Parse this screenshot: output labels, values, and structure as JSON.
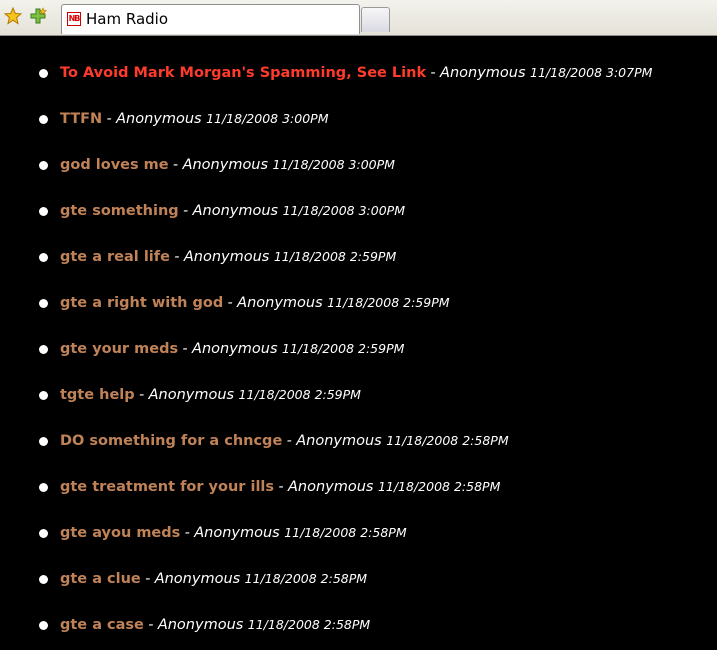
{
  "browser": {
    "tab_title": "Ham Radio",
    "tab_favicon_text": "NB",
    "icons": [
      "star-icon",
      "add-bookmark-icon",
      "favicon-icon"
    ]
  },
  "colors": {
    "background": "#000000",
    "link": "#c08257",
    "link_highlight": "#ff3b2b",
    "text": "#ffffff"
  },
  "posts": [
    {
      "title": "To Avoid Mark Morgan's Spamming, See Link",
      "author": "Anonymous",
      "date": "11/18/2008 3:07PM",
      "highlight": true
    },
    {
      "title": "TTFN",
      "author": "Anonymous",
      "date": "11/18/2008 3:00PM"
    },
    {
      "title": "god loves me",
      "author": "Anonymous",
      "date": "11/18/2008 3:00PM"
    },
    {
      "title": "gte something",
      "author": "Anonymous",
      "date": "11/18/2008 3:00PM"
    },
    {
      "title": "gte a real life",
      "author": "Anonymous",
      "date": "11/18/2008 2:59PM"
    },
    {
      "title": "gte a right with god",
      "author": "Anonymous",
      "date": "11/18/2008 2:59PM"
    },
    {
      "title": "gte your meds",
      "author": "Anonymous",
      "date": "11/18/2008 2:59PM"
    },
    {
      "title": "tgte help",
      "author": "Anonymous",
      "date": "11/18/2008 2:59PM"
    },
    {
      "title": "DO something for a chncge",
      "author": "Anonymous",
      "date": "11/18/2008 2:58PM"
    },
    {
      "title": "gte treatment for your ills",
      "author": "Anonymous",
      "date": "11/18/2008 2:58PM"
    },
    {
      "title": "gte ayou meds",
      "author": "Anonymous",
      "date": "11/18/2008 2:58PM"
    },
    {
      "title": "gte a clue",
      "author": "Anonymous",
      "date": "11/18/2008 2:58PM"
    },
    {
      "title": "gte a case",
      "author": "Anonymous",
      "date": "11/18/2008 2:58PM"
    }
  ]
}
